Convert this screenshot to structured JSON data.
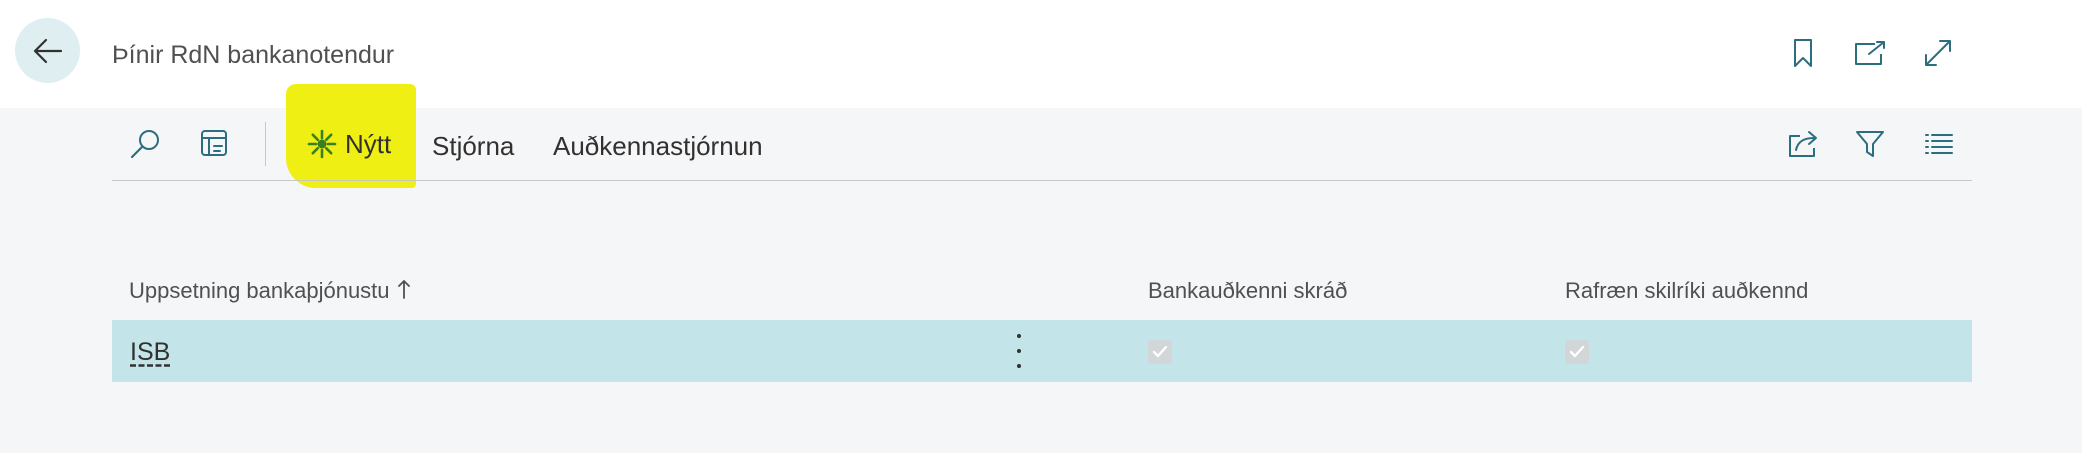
{
  "header": {
    "title": "Þínir RdN bankanotendur",
    "back_icon": "arrow-left-icon",
    "icons": [
      "bookmark-icon",
      "open-in-new-window-icon",
      "expand-icon"
    ]
  },
  "toolbar": {
    "search_icon": "search-icon",
    "layout_icon": "edit-list-icon",
    "new_label": "Nýtt",
    "new_icon": "sun-burst-new-icon",
    "manage_label": "Stjórna",
    "auth_label": "Auðkennastjórnun",
    "right_icons": [
      "share-icon",
      "filter-icon",
      "list-view-icon"
    ],
    "highlight_color": "#eeee00"
  },
  "table": {
    "columns": [
      {
        "label": "Uppsetning bankaþjónustu",
        "sort": "ascending"
      },
      {
        "label": "Bankauðkenni skráð"
      },
      {
        "label": "Rafræn skilríki auðkennd"
      }
    ],
    "rows": [
      {
        "name": "ISB",
        "bank_id_registered": true,
        "e_id_authenticated": true,
        "selected": true
      }
    ]
  },
  "colors": {
    "accent": "#c3e5ea",
    "back_button": "#dfeef0",
    "background": "#f5f6f8"
  }
}
